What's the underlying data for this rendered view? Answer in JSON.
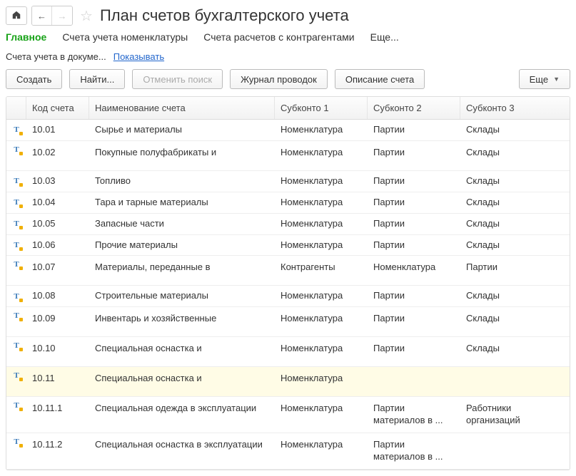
{
  "header": {
    "title": "План счетов бухгалтерского учета"
  },
  "tabs": {
    "main": "Главное",
    "accounts_nomenclature": "Счета учета номенклатуры",
    "accounts_contractors": "Счета расчетов с контрагентами",
    "more": "Еще..."
  },
  "filter": {
    "label": "Счета учета в докуме...",
    "link": "Показывать"
  },
  "toolbar": {
    "create": "Создать",
    "find": "Найти...",
    "cancel_search": "Отменить поиск",
    "journal": "Журнал проводок",
    "description": "Описание счета",
    "more": "Еще"
  },
  "columns": {
    "code": "Код счета",
    "name": "Наименование счета",
    "sub1": "Субконто 1",
    "sub2": "Субконто 2",
    "sub3": "Субконто 3"
  },
  "rows": [
    {
      "code": "10.01",
      "name": "Сырье и материалы",
      "sub1": "Номенклатура",
      "sub2": "Партии",
      "sub3": "Склады"
    },
    {
      "code": "10.02",
      "name": "Покупные полуфабрикаты и",
      "sub1": "Номенклатура",
      "sub2": "Партии",
      "sub3": "Склады",
      "tall": true
    },
    {
      "code": "10.03",
      "name": "Топливо",
      "sub1": "Номенклатура",
      "sub2": "Партии",
      "sub3": "Склады"
    },
    {
      "code": "10.04",
      "name": "Тара и тарные материалы",
      "sub1": "Номенклатура",
      "sub2": "Партии",
      "sub3": "Склады"
    },
    {
      "code": "10.05",
      "name": "Запасные части",
      "sub1": "Номенклатура",
      "sub2": "Партии",
      "sub3": "Склады"
    },
    {
      "code": "10.06",
      "name": "Прочие материалы",
      "sub1": "Номенклатура",
      "sub2": "Партии",
      "sub3": "Склады"
    },
    {
      "code": "10.07",
      "name": "Материалы, переданные в",
      "sub1": "Контрагенты",
      "sub2": "Номенклатура",
      "sub3": "Партии",
      "tall": true
    },
    {
      "code": "10.08",
      "name": "Строительные материалы",
      "sub1": "Номенклатура",
      "sub2": "Партии",
      "sub3": "Склады"
    },
    {
      "code": "10.09",
      "name": "Инвентарь и хозяйственные",
      "sub1": "Номенклатура",
      "sub2": "Партии",
      "sub3": "Склады",
      "tall": true
    },
    {
      "code": "10.10",
      "name": "Специальная оснастка и",
      "sub1": "Номенклатура",
      "sub2": "Партии",
      "sub3": "Склады",
      "tall": true
    },
    {
      "code": "10.11",
      "name": "Специальная оснастка и",
      "sub1": "Номенклатура",
      "sub2": "",
      "sub3": "",
      "highlight": true,
      "tall": true
    },
    {
      "code": "10.11.1",
      "name": "Специальная одежда в эксплуатации",
      "sub1": "Номенклатура",
      "sub2": "Партии материалов в ...",
      "sub3": "Работники организаций",
      "tall": true
    },
    {
      "code": "10.11.2",
      "name": "Специальная оснастка в эксплуатации",
      "sub1": "Номенклатура",
      "sub2": "Партии материалов в ...",
      "sub3": "",
      "tall": true
    }
  ]
}
